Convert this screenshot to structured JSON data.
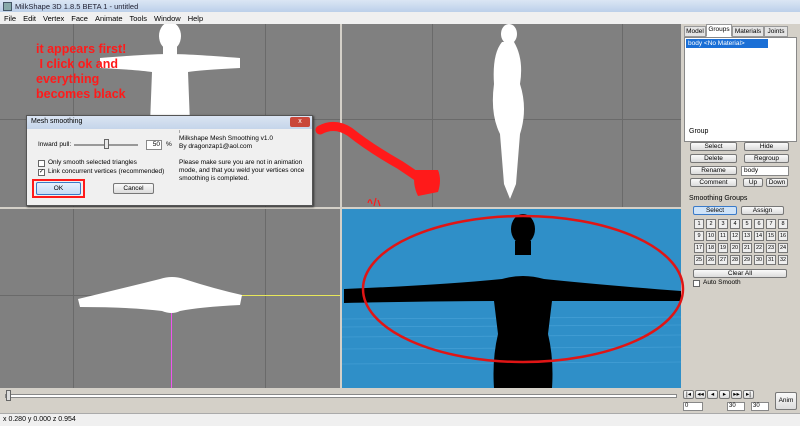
{
  "window": {
    "title": "MilkShape 3D 1.8.5 BETA 1 - untitled"
  },
  "menu": [
    "File",
    "Edit",
    "Vertex",
    "Face",
    "Animate",
    "Tools",
    "Window",
    "Help"
  ],
  "tabs": [
    "Model",
    "Groups",
    "Materials",
    "Joints"
  ],
  "groups_list": [
    "body <No Material>"
  ],
  "group_section": {
    "title": "Group",
    "buttons": {
      "select": "Select",
      "hide": "Hide",
      "delete": "Delete",
      "regroup": "Regroup",
      "rename": "Rename",
      "comment": "Comment",
      "up": "Up",
      "down": "Down"
    },
    "name_value": "body"
  },
  "smoothing": {
    "title": "Smoothing Groups",
    "select": "Select",
    "assign": "Assign",
    "numbers": [
      "1",
      "2",
      "3",
      "4",
      "5",
      "6",
      "7",
      "8",
      "9",
      "10",
      "11",
      "12",
      "13",
      "14",
      "15",
      "16",
      "17",
      "18",
      "19",
      "20",
      "21",
      "22",
      "23",
      "24",
      "25",
      "26",
      "27",
      "28",
      "29",
      "30",
      "31",
      "32"
    ],
    "clear_all": "Clear All",
    "auto_smooth": "Auto Smooth"
  },
  "dialog": {
    "title": "Mesh smoothing",
    "close": "x",
    "inward_pull": "Inward pull:",
    "value": "50",
    "unit": "%",
    "only_smooth": "Only smooth selected triangles",
    "link_vertices": "Link concurrent vertices (recommended)",
    "ok": "OK",
    "cancel": "Cancel",
    "info_title": "Milkshape Mesh Smoothing v1.0",
    "info_by": "By dragonzap1@aol.com",
    "info_text": "Please make sure you are not in animation mode, and that you weld your vertices once smoothing is completed."
  },
  "annotation": {
    "text": [
      "it appears first!",
      " I click ok and",
      "everything",
      "becomes black"
    ]
  },
  "timeline": {
    "start": "0",
    "end": "30",
    "frame": "30",
    "anim": "Anim"
  },
  "status": "x 0.280 y 0.000 z 0.954",
  "colors": {
    "accent": "#1a6fd6",
    "viewport_gray": "#808080",
    "perspective_bg": "#2f8fc8",
    "annotation_red": "#ff1a1a"
  }
}
